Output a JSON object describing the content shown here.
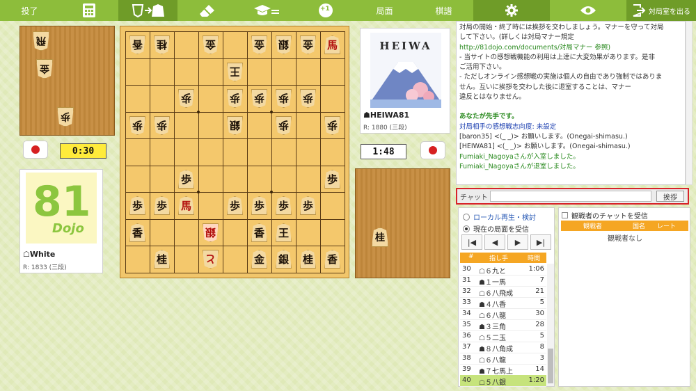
{
  "toolbar": {
    "resign": "投了",
    "board_view": "局面",
    "kifu": "棋譜",
    "exit": "対局室を出る",
    "plus_one": "+1"
  },
  "board": {
    "pieces": [
      {
        "col": 9,
        "row": 1,
        "char": "香",
        "side": "gote"
      },
      {
        "col": 8,
        "row": 1,
        "char": "桂",
        "side": "gote"
      },
      {
        "col": 6,
        "row": 1,
        "char": "金",
        "side": "gote"
      },
      {
        "col": 4,
        "row": 1,
        "char": "金",
        "side": "gote"
      },
      {
        "col": 3,
        "row": 1,
        "char": "銀",
        "side": "gote"
      },
      {
        "col": 2,
        "row": 1,
        "char": "金",
        "side": "gote"
      },
      {
        "col": 1,
        "row": 1,
        "char": "馬",
        "side": "sente",
        "red": true
      },
      {
        "col": 5,
        "row": 2,
        "char": "王",
        "side": "gote"
      },
      {
        "col": 7,
        "row": 3,
        "char": "歩",
        "side": "gote"
      },
      {
        "col": 5,
        "row": 3,
        "char": "歩",
        "side": "gote"
      },
      {
        "col": 4,
        "row": 3,
        "char": "歩",
        "side": "gote"
      },
      {
        "col": 3,
        "row": 3,
        "char": "歩",
        "side": "gote"
      },
      {
        "col": 2,
        "row": 3,
        "char": "歩",
        "side": "gote"
      },
      {
        "col": 9,
        "row": 4,
        "char": "歩",
        "side": "gote"
      },
      {
        "col": 8,
        "row": 4,
        "char": "歩",
        "side": "gote"
      },
      {
        "col": 5,
        "row": 4,
        "char": "銀",
        "side": "gote"
      },
      {
        "col": 3,
        "row": 4,
        "char": "歩",
        "side": "gote"
      },
      {
        "col": 1,
        "row": 4,
        "char": "歩",
        "side": "gote"
      },
      {
        "col": 7,
        "row": 6,
        "char": "歩",
        "side": "sente"
      },
      {
        "col": 1,
        "row": 6,
        "char": "歩",
        "side": "sente"
      },
      {
        "col": 9,
        "row": 7,
        "char": "歩",
        "side": "sente"
      },
      {
        "col": 8,
        "row": 7,
        "char": "歩",
        "side": "sente"
      },
      {
        "col": 7,
        "row": 7,
        "char": "馬",
        "side": "sente",
        "red": true
      },
      {
        "col": 5,
        "row": 7,
        "char": "歩",
        "side": "sente"
      },
      {
        "col": 4,
        "row": 7,
        "char": "歩",
        "side": "sente"
      },
      {
        "col": 3,
        "row": 7,
        "char": "歩",
        "side": "sente"
      },
      {
        "col": 2,
        "row": 7,
        "char": "歩",
        "side": "sente"
      },
      {
        "col": 9,
        "row": 8,
        "char": "香",
        "side": "sente"
      },
      {
        "col": 6,
        "row": 8,
        "char": "銀",
        "side": "gote",
        "red": true,
        "hl": true
      },
      {
        "col": 4,
        "row": 8,
        "char": "香",
        "side": "sente"
      },
      {
        "col": 3,
        "row": 8,
        "char": "王",
        "side": "sente"
      },
      {
        "col": 8,
        "row": 9,
        "char": "桂",
        "side": "sente"
      },
      {
        "col": 6,
        "row": 9,
        "char": "と",
        "side": "gote",
        "red": true
      },
      {
        "col": 4,
        "row": 9,
        "char": "金",
        "side": "sente"
      },
      {
        "col": 3,
        "row": 9,
        "char": "銀",
        "side": "sente"
      },
      {
        "col": 2,
        "row": 9,
        "char": "桂",
        "side": "sente"
      },
      {
        "col": 1,
        "row": 9,
        "char": "香",
        "side": "sente"
      }
    ]
  },
  "gote_hand": [
    "飛",
    "金",
    "歩"
  ],
  "sente_hand": [
    "桂"
  ],
  "players": {
    "gote": {
      "name": "☖White",
      "rating": "R: 1833 (三段)",
      "clock": "0:30",
      "avatar_text": "81",
      "avatar_sub": "Dojo"
    },
    "sente": {
      "name": "☗HEIWA81",
      "rating": "R: 1880 (三段)",
      "clock": "1:48",
      "avatar_text": "HEIWA"
    }
  },
  "chat_log": [
    {
      "text": "対局の開始・終了時には挨拶を交わしましょう。マナーを守って対局",
      "cls": ""
    },
    {
      "text": "して下さい。(詳しくは対局マナー規定",
      "cls": ""
    },
    {
      "text": "http://81dojo.com/documents/対局マナー 参照)",
      "cls": "c-green"
    },
    {
      "text": "- 当サイトの感想戦機能の利用は上達に大変効果があります。是非",
      "cls": ""
    },
    {
      "text": "ご活用下さい。",
      "cls": ""
    },
    {
      "text": "- ただしオンライン感想戦の実施は個人の自由であり強制ではありま",
      "cls": ""
    },
    {
      "text": "せん。互いに挨拶を交わした後に退室することは、マナー",
      "cls": ""
    },
    {
      "text": "違反とはなりません。",
      "cls": ""
    },
    {
      "text": "",
      "cls": ""
    },
    {
      "text": "あなたが先手です。",
      "cls": "c-greenb"
    },
    {
      "text": "対局相手の感想戦志向度: 未設定",
      "cls": "c-blue"
    },
    {
      "text": "[baron35] <(_ _)> お願いします。(Onegai-shimasu.)",
      "cls": ""
    },
    {
      "text": "[HEIWA81] <(_ _)> お願いします。(Onegai-shimasu.)",
      "cls": ""
    },
    {
      "text": "Fumiaki_Nagoyaさんが入室しました。",
      "cls": "c-green"
    },
    {
      "text": "Fumiaki_Nagoyaさんが退室しました。",
      "cls": "c-green"
    }
  ],
  "chat": {
    "label": "チャット",
    "input_value": "",
    "send_label": "挨拶"
  },
  "replay": {
    "local_label": "ローカル再生・検討",
    "sync_label": "現在の局面を受信",
    "nav": [
      "|◀",
      "◀",
      "▶",
      "▶|"
    ],
    "header": {
      "num": "#",
      "move": "指し手",
      "time": "時間"
    },
    "moves": [
      {
        "n": "30",
        "m": "☖６九と",
        "t": "1:06"
      },
      {
        "n": "31",
        "m": "☗１一馬",
        "t": "7"
      },
      {
        "n": "32",
        "m": "☖６八飛成",
        "t": "21"
      },
      {
        "n": "33",
        "m": "☗４八香",
        "t": "5"
      },
      {
        "n": "34",
        "m": "☖６八龍",
        "t": "30"
      },
      {
        "n": "35",
        "m": "☗３三角",
        "t": "28"
      },
      {
        "n": "36",
        "m": "☖５二玉",
        "t": "5"
      },
      {
        "n": "37",
        "m": "☗８八角成",
        "t": "8"
      },
      {
        "n": "38",
        "m": "☖６八龍",
        "t": "3"
      },
      {
        "n": "39",
        "m": "☗７七馬上",
        "t": "14"
      },
      {
        "n": "40",
        "m": "☖５八銀",
        "t": "1:20"
      }
    ]
  },
  "watchers": {
    "check_label": "観戦者のチャットを受信",
    "header": {
      "name": "観戦者",
      "country": "国名",
      "rate": "レート"
    },
    "empty": "観戦者なし"
  }
}
